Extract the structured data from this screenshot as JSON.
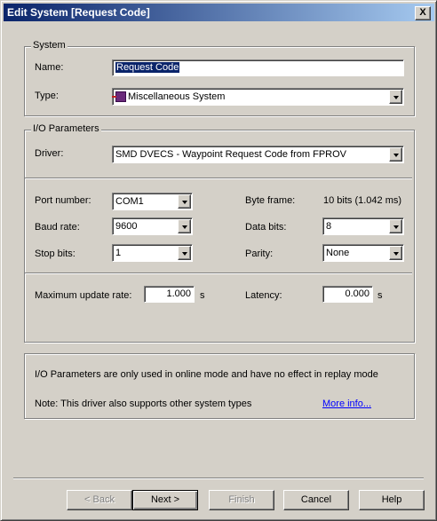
{
  "window": {
    "title": "Edit System [Request Code]",
    "close_label": "X"
  },
  "system": {
    "group_label": "System",
    "name_label": "Name:",
    "name_value": "Request Code",
    "type_label": "Type:",
    "type_value": "Miscellaneous System",
    "type_icon": "misc-system-icon"
  },
  "io": {
    "group_label": "I/O Parameters",
    "driver_label": "Driver:",
    "driver_value": "SMD DVECS - Waypoint Request Code from FPROV",
    "port_label": "Port number:",
    "port_value": "COM1",
    "baud_label": "Baud rate:",
    "baud_value": "9600",
    "stop_label": "Stop bits:",
    "stop_value": "1",
    "byteframe_label": "Byte frame:",
    "byteframe_value": "10 bits (1.042 ms)",
    "databits_label": "Data bits:",
    "databits_value": "8",
    "parity_label": "Parity:",
    "parity_value": "None",
    "maxrate_label": "Maximum update rate:",
    "maxrate_value": "1.000",
    "maxrate_unit": "s",
    "latency_label": "Latency:",
    "latency_value": "0.000",
    "latency_unit": "s"
  },
  "info": {
    "line1": "I/O Parameters are only used in online mode and have no effect in replay mode",
    "line2": "Note: This driver also supports other system types",
    "more_link": "More info..."
  },
  "buttons": {
    "back": "< Back",
    "next": "Next >",
    "finish": "Finish",
    "cancel": "Cancel",
    "help": "Help"
  },
  "colors": {
    "title_start": "#0a246a",
    "title_end": "#a6caf0",
    "face": "#d4d0c8",
    "link": "#0000ff"
  }
}
